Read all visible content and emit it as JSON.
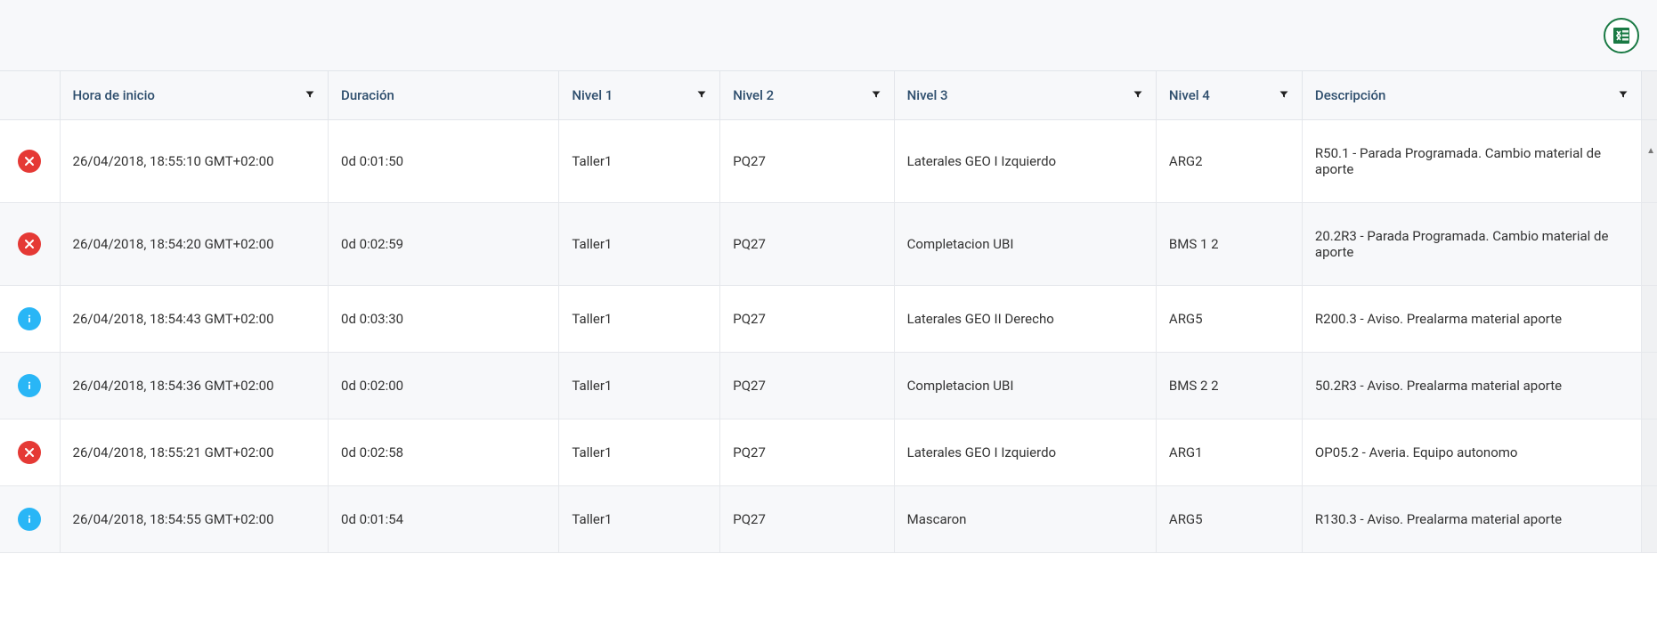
{
  "toolbar": {
    "export_excel_label": "Exportar a Excel"
  },
  "columns": {
    "icon": "",
    "start": "Hora de inicio",
    "duration": "Duración",
    "n1": "Nivel 1",
    "n2": "Nivel 2",
    "n3": "Nivel 3",
    "n4": "Nivel 4",
    "desc": "Descripción"
  },
  "rows": [
    {
      "status": "error",
      "start": "26/04/2018, 18:55:10 GMT+02:00",
      "duration": "0d 0:01:50",
      "n1": "Taller1",
      "n2": "PQ27",
      "n3": "Laterales GEO I Izquierdo",
      "n4": "ARG2",
      "desc": "R50.1 - Parada Programada. Cambio material de aporte"
    },
    {
      "status": "error",
      "start": "26/04/2018, 18:54:20 GMT+02:00",
      "duration": "0d 0:02:59",
      "n1": "Taller1",
      "n2": "PQ27",
      "n3": "Completacion UBI",
      "n4": "BMS 1 2",
      "desc": "20.2R3 - Parada Programada. Cambio material de aporte"
    },
    {
      "status": "info",
      "start": "26/04/2018, 18:54:43 GMT+02:00",
      "duration": "0d 0:03:30",
      "n1": "Taller1",
      "n2": "PQ27",
      "n3": "Laterales GEO II Derecho",
      "n4": "ARG5",
      "desc": "R200.3 - Aviso. Prealarma material aporte"
    },
    {
      "status": "info",
      "start": "26/04/2018, 18:54:36 GMT+02:00",
      "duration": "0d 0:02:00",
      "n1": "Taller1",
      "n2": "PQ27",
      "n3": "Completacion UBI",
      "n4": "BMS 2 2",
      "desc": "50.2R3 - Aviso. Prealarma material aporte"
    },
    {
      "status": "error",
      "start": "26/04/2018, 18:55:21 GMT+02:00",
      "duration": "0d 0:02:58",
      "n1": "Taller1",
      "n2": "PQ27",
      "n3": "Laterales GEO I Izquierdo",
      "n4": "ARG1",
      "desc": "OP05.2 - Averia. Equipo autonomo"
    },
    {
      "status": "info",
      "start": "26/04/2018, 18:54:55 GMT+02:00",
      "duration": "0d 0:01:54",
      "n1": "Taller1",
      "n2": "PQ27",
      "n3": "Mascaron",
      "n4": "ARG5",
      "desc": "R130.3 - Aviso. Prealarma material aporte"
    }
  ]
}
